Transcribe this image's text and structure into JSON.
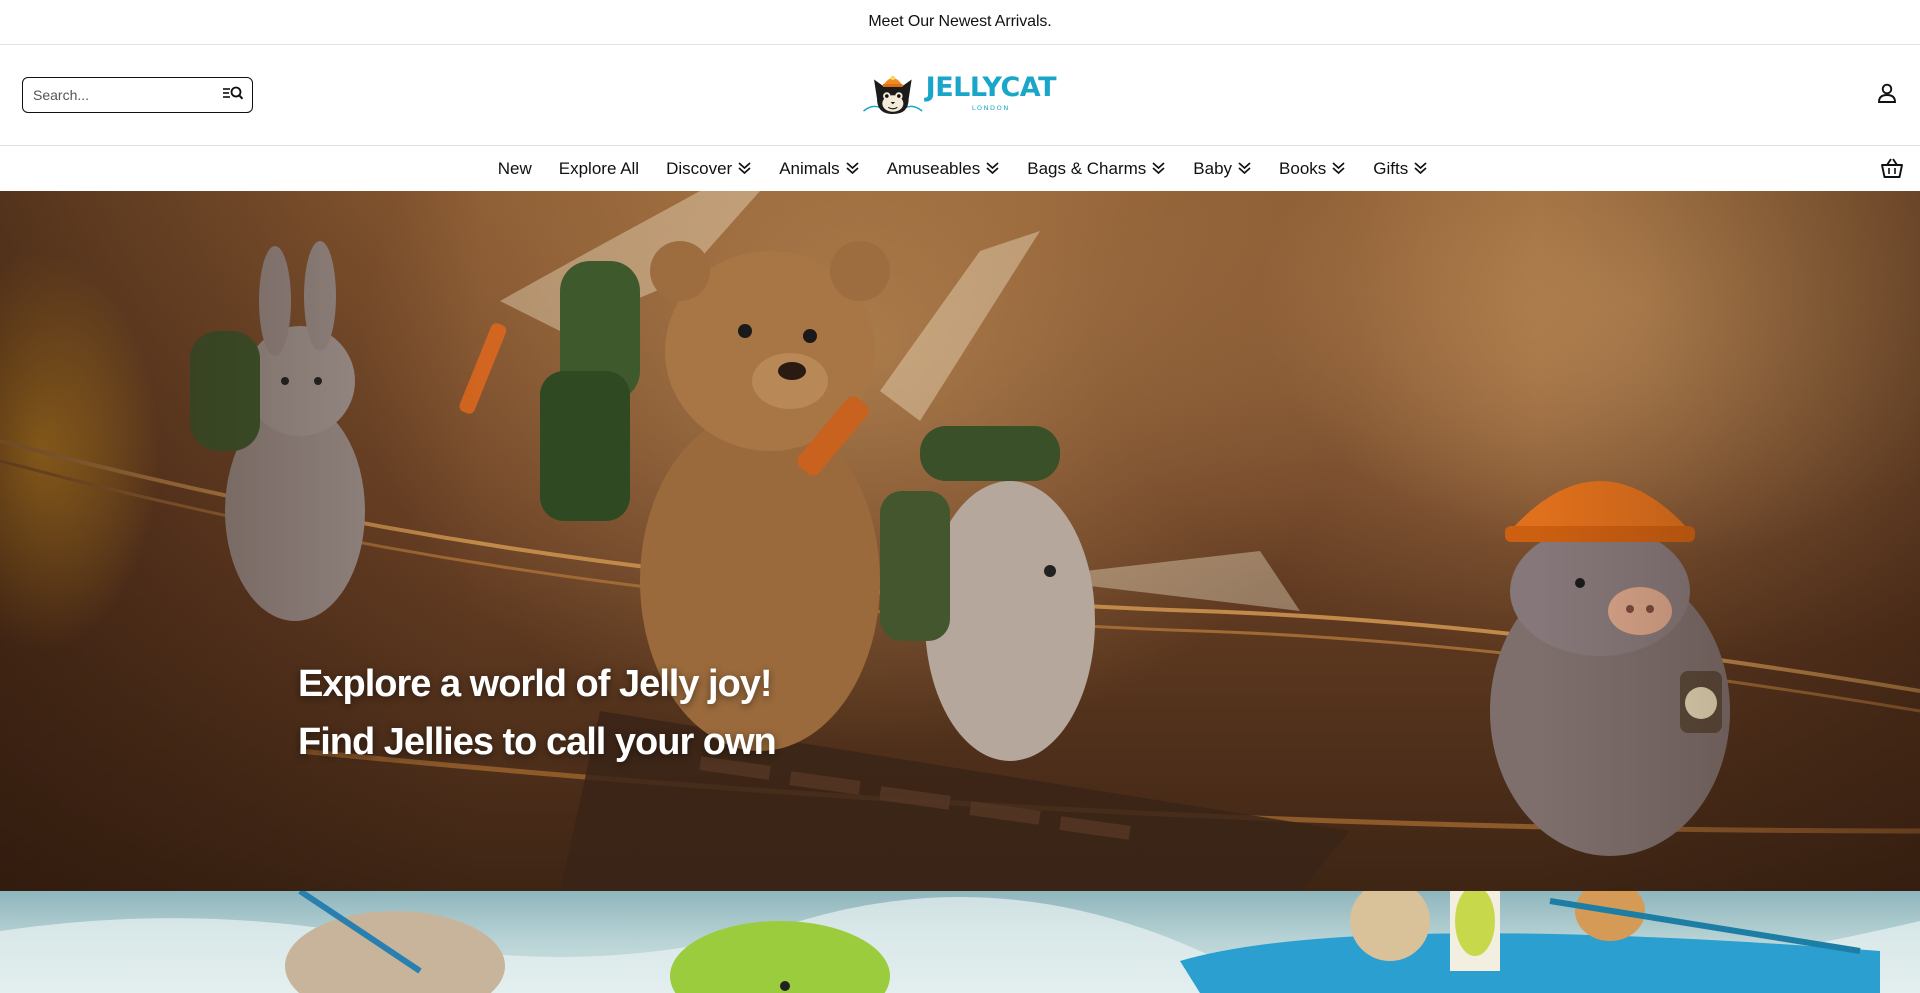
{
  "announcement": {
    "text": "Meet Our Newest Arrivals."
  },
  "header": {
    "search": {
      "placeholder": "Search..."
    },
    "logo": {
      "word": "JELLYCAT",
      "sub": "LONDON"
    }
  },
  "nav": {
    "items": [
      {
        "label": "New",
        "dropdown": false
      },
      {
        "label": "Explore All",
        "dropdown": false
      },
      {
        "label": "Discover",
        "dropdown": true
      },
      {
        "label": "Animals",
        "dropdown": true
      },
      {
        "label": "Amuseables",
        "dropdown": true
      },
      {
        "label": "Bags & Charms",
        "dropdown": true
      },
      {
        "label": "Baby",
        "dropdown": true
      },
      {
        "label": "Books",
        "dropdown": true
      },
      {
        "label": "Gifts",
        "dropdown": true
      }
    ]
  },
  "hero": {
    "line1": "Explore a world of Jelly joy!",
    "line2": "Find Jellies to call your own"
  },
  "colors": {
    "brand": "#19a6c9",
    "text": "#111111",
    "divider": "#e3e3e3"
  }
}
